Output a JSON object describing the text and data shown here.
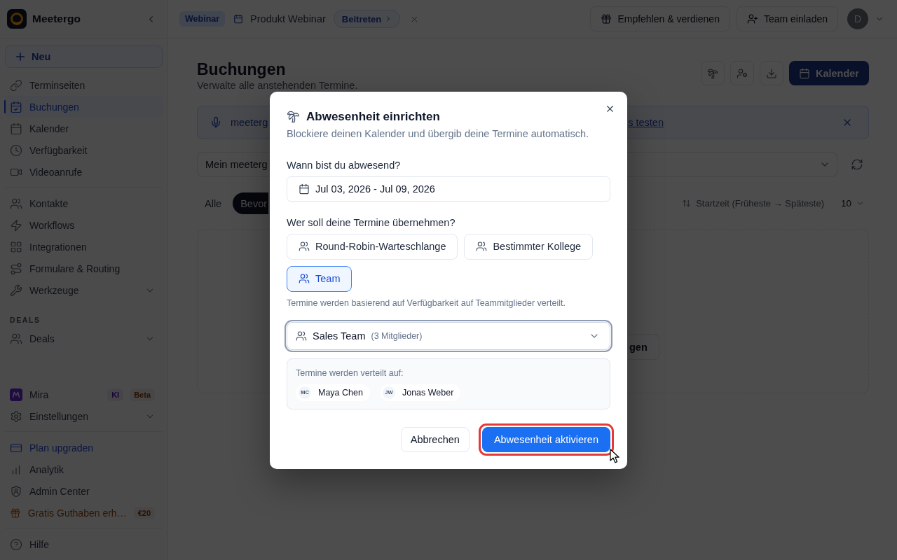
{
  "sidebar": {
    "brand": "Meetergo",
    "new_button": "Neu",
    "nav_main": [
      {
        "label": "Terminseiten",
        "selected": false
      },
      {
        "label": "Buchungen",
        "selected": true
      },
      {
        "label": "Kalender",
        "selected": false
      },
      {
        "label": "Verfügbarkeit",
        "selected": false
      },
      {
        "label": "Videoanrufe",
        "selected": false
      }
    ],
    "nav_tools": [
      {
        "label": "Kontakte",
        "selected": false
      },
      {
        "label": "Workflows",
        "selected": false
      },
      {
        "label": "Integrationen",
        "selected": false
      },
      {
        "label": "Formulare & Routing",
        "selected": false
      },
      {
        "label": "Werkzeuge",
        "selected": false,
        "expanded": false
      }
    ],
    "deals": {
      "heading": "DEALS",
      "items": [
        {
          "label": "Deals",
          "selected": false,
          "expanded": false
        }
      ]
    },
    "nav_settings": [
      {
        "label": "Mira",
        "selected": false,
        "badges": [
          {
            "text": "KI",
            "color": "#180635"
          },
          {
            "text": "Beta",
            "color": "#261100"
          }
        ]
      },
      {
        "label": "Einstellungen",
        "selected": false,
        "expanded": false
      }
    ],
    "nav_account": [
      {
        "label": "Plan upgraden",
        "kind": "upgrade",
        "selected": false
      },
      {
        "label": "Analytik",
        "kind": "link",
        "selected": false
      },
      {
        "label": "Admin Center",
        "kind": "link",
        "selected": false
      },
      {
        "label": "Gratis Guthaben erh…",
        "kind": "promo",
        "selected": false,
        "badges": [
          {
            "text": "€20",
            "color": "#261100"
          }
        ]
      }
    ],
    "nav_help": [
      {
        "label": "Hilfe",
        "selected": false
      }
    ]
  },
  "topbar": {
    "event_type": "Webinar",
    "event_title": "Produkt Webinar",
    "join_button": "Beitreten",
    "actions": [
      "Empfehlen & verdienen",
      "Team einladen"
    ],
    "avatar_initial": "D"
  },
  "page": {
    "title": "Buchungen",
    "subtitle": "Verwalte alle anstehenden Termine.",
    "calendar_button": "Kalender",
    "banner": {
      "text": "meeterg",
      "link": "s testen"
    },
    "filter_select": {
      "value": "Mein meeterg"
    },
    "tabs": [
      {
        "label": "Alle",
        "selected": false
      },
      {
        "label": "Bevor",
        "selected": true
      }
    ],
    "sort": {
      "label": "Startzeit (Früheste → Späteste)"
    },
    "page_size": {
      "value": "10"
    },
    "empty_state": {
      "button": "gen"
    }
  },
  "dialog": {
    "title": "Abwesenheit einrichten",
    "subtitle": "Blockiere deinen Kalender und übergib deine Termine automatisch.",
    "date_label": "Wann bist du abwesend?",
    "date_range": {
      "value": "Jul 03, 2026 - Jul 09, 2026"
    },
    "handover_label": "Wer soll deine Termine übernehmen?",
    "handover_options": [
      {
        "label": "Round-Robin-Warteschlange",
        "selected": false
      },
      {
        "label": "Bestimmter Kollege",
        "selected": false
      },
      {
        "label": "Team",
        "selected": true
      }
    ],
    "handover_hint": "Termine werden basierend auf Verfügbarkeit auf Teammitglieder verteilt.",
    "team_select": {
      "value": "Sales Team",
      "count": "(3 Mitglieder)",
      "focused": true
    },
    "members": {
      "heading": "Termine werden verteilt auf:",
      "people": [
        {
          "initials": "MC",
          "name": "Maya Chen"
        },
        {
          "initials": "JW",
          "name": "Jonas Weber"
        }
      ]
    },
    "buttons": [
      {
        "label": "Abbrechen",
        "kind": "secondary",
        "highlighted": false
      },
      {
        "label": "Abwesenheit aktivieren",
        "kind": "primary",
        "highlighted": true
      }
    ]
  }
}
